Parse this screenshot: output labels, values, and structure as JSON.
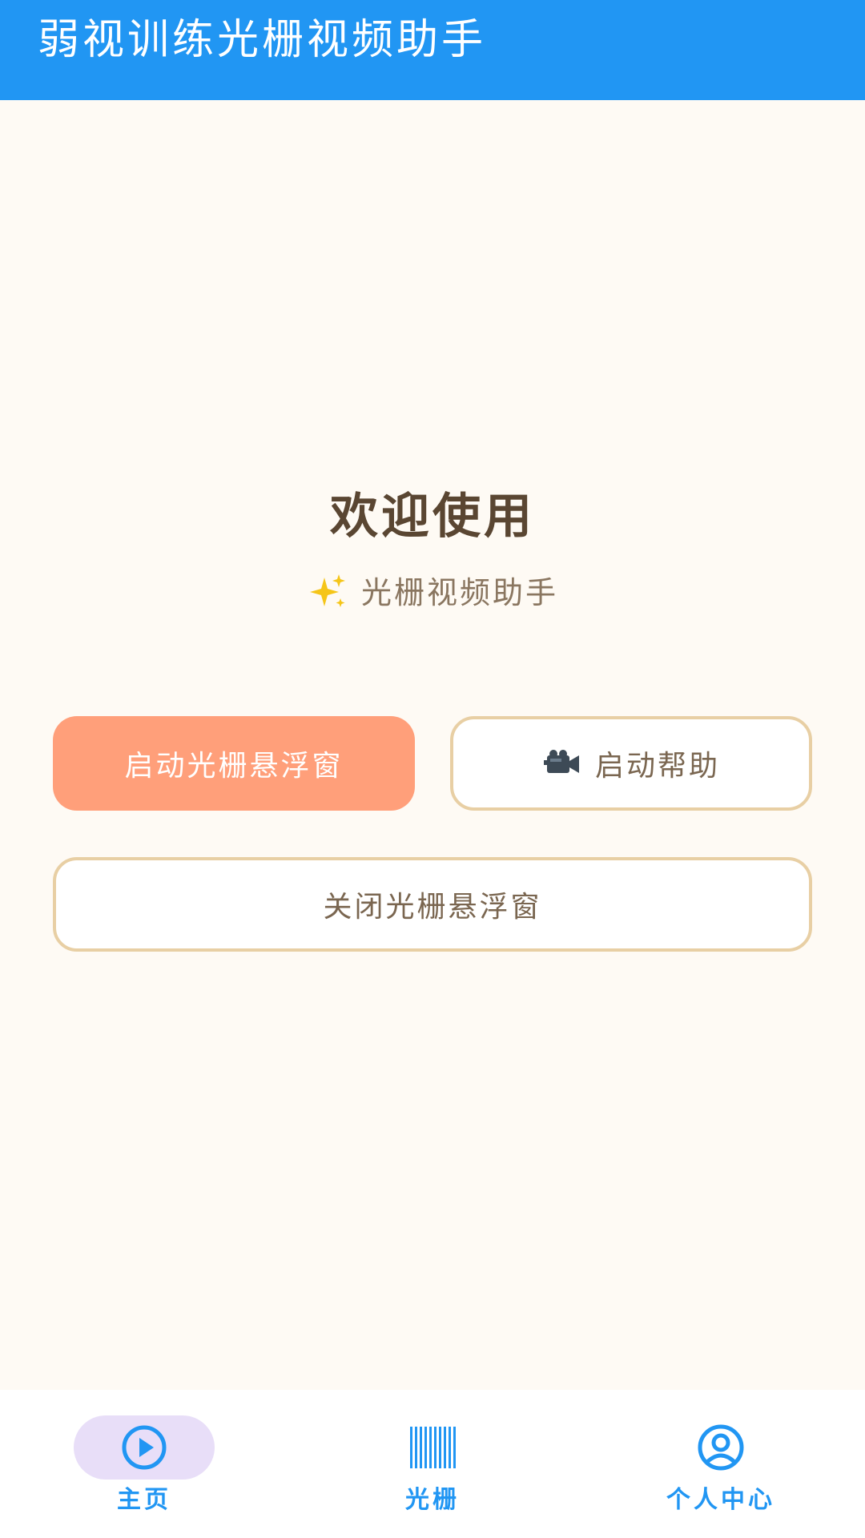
{
  "app_bar": {
    "title": "弱视训练光栅视频助手"
  },
  "main": {
    "welcome_title": "欢迎使用",
    "subtitle_icon": "sparkles-icon",
    "subtitle": "光栅视频助手",
    "buttons": {
      "start_float_label": "启动光栅悬浮窗",
      "start_help_icon": "video-camera-icon",
      "start_help_label": "启动帮助",
      "close_float_label": "关闭光栅悬浮窗"
    }
  },
  "bottom_nav": {
    "items": [
      {
        "label": "主页",
        "icon": "play-circle-icon",
        "selected": true
      },
      {
        "label": "光栅",
        "icon": "barcode-grating-icon",
        "selected": false
      },
      {
        "label": "个人中心",
        "icon": "account-circle-icon",
        "selected": false
      }
    ]
  },
  "colors": {
    "app_bar": "#2196f3",
    "background": "#fefaf4",
    "primary_button": "#ff9f7a",
    "outline_button_border": "#e8cfa4",
    "nav_accent": "#2196f3",
    "nav_selected_pill": "#e8def8",
    "title_text": "#5a4632"
  }
}
